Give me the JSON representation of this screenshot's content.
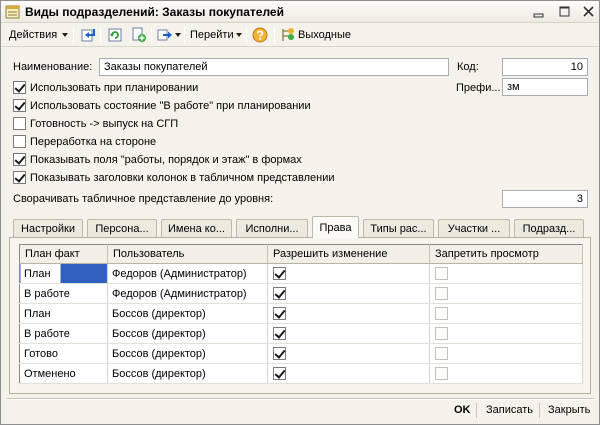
{
  "window": {
    "title": "Виды подразделений: Заказы покупателей",
    "icon": "form-icon"
  },
  "toolbar": {
    "actions_label": "Действия",
    "goto_label": "Перейти",
    "holidays_label": "Выходные",
    "icons": [
      "move-icon",
      "refresh-icon",
      "copy-icon",
      "send-icon",
      "help-icon",
      "holidays-icon"
    ]
  },
  "form": {
    "name_label": "Наименование:",
    "name_value": "Заказы покупателей",
    "code_label": "Код:",
    "code_value": "10",
    "prefix_label": "Префи...",
    "prefix_value": "зм",
    "checkboxes": [
      {
        "label": "Использовать при планировании",
        "checked": true
      },
      {
        "label": "Использовать состояние \"В работе\" при планировании",
        "checked": true
      },
      {
        "label": "Готовность -> выпуск на СГП",
        "checked": false
      },
      {
        "label": "Переработка на стороне",
        "checked": false
      },
      {
        "label": "Показывать поля \"работы, порядок и этаж\" в формах",
        "checked": true
      },
      {
        "label": "Показывать заголовки колонок в табличном представлении",
        "checked": true
      }
    ],
    "collapse_label": "Сворачивать табличное представление до уровня:",
    "collapse_value": "3"
  },
  "tabs": {
    "items": [
      "Настройки",
      "Персона...",
      "Имена ко...",
      "Исполни...",
      "Права",
      "Типы рас...",
      "Участки ...",
      "Подразд..."
    ],
    "active_index": 4
  },
  "table": {
    "columns": [
      "План факт",
      "Пользователь",
      "Разрешить изменение",
      "Запретить просмотр"
    ],
    "rows": [
      {
        "plan": "План",
        "user": "Федоров (Администратор)",
        "allow_edit": true,
        "deny_view": false
      },
      {
        "plan": "В работе",
        "user": "Федоров (Администратор)",
        "allow_edit": true,
        "deny_view": false
      },
      {
        "plan": "План",
        "user": "Боссов (директор)",
        "allow_edit": true,
        "deny_view": false
      },
      {
        "plan": "В работе",
        "user": "Боссов (директор)",
        "allow_edit": true,
        "deny_view": false
      },
      {
        "plan": "Готово",
        "user": "Боссов (директор)",
        "allow_edit": true,
        "deny_view": false
      },
      {
        "plan": "Отменено",
        "user": "Боссов (директор)",
        "allow_edit": true,
        "deny_view": false
      }
    ]
  },
  "footer": {
    "ok_label": "OK",
    "save_label": "Записать",
    "close_label": "Закрыть"
  },
  "colors": {
    "form_bg": "#F4F2EA",
    "selection": "#2F62BE"
  }
}
